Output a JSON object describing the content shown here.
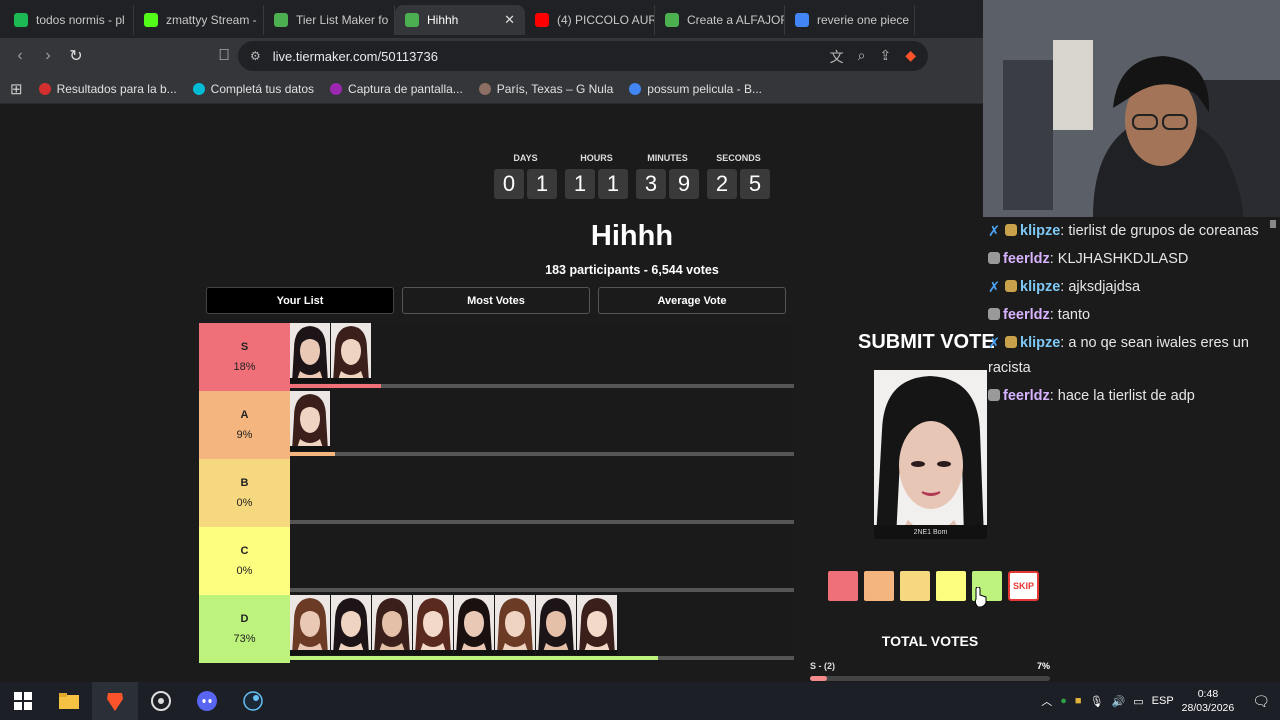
{
  "browser": {
    "tabs": [
      {
        "label": "todos normis - pl",
        "color": "#1db954"
      },
      {
        "label": "zmattyy Stream -",
        "color": "#53fc18"
      },
      {
        "label": "Tier List Maker fo",
        "color": "#4caf50"
      },
      {
        "label": "Hihhh",
        "color": "#4caf50",
        "active": true
      },
      {
        "label": "(4) PICCOLO AUR",
        "color": "#ff0000"
      },
      {
        "label": "Create a ALFAJOR",
        "color": "#4caf50"
      },
      {
        "label": "reverie one piece",
        "color": "#4285f4"
      }
    ],
    "close_glyph": "✕",
    "url": "live.tiermaker.com/50113736",
    "bookmarks": [
      {
        "label": "Resultados para la b...",
        "color": "#d32f2f"
      },
      {
        "label": "Completá tus datos",
        "color": "#00bcd4"
      },
      {
        "label": "Captura de pantalla...",
        "color": "#9c27b0"
      },
      {
        "label": "París, Texas – G Nula",
        "color": "#8d6e63"
      },
      {
        "label": "possum pelicula - B...",
        "color": "#4285f4"
      }
    ]
  },
  "countdown": {
    "units": [
      {
        "label": "DAYS",
        "digits": [
          "0",
          "1"
        ]
      },
      {
        "label": "HOURS",
        "digits": [
          "1",
          "1"
        ]
      },
      {
        "label": "MINUTES",
        "digits": [
          "3",
          "9"
        ]
      },
      {
        "label": "SECONDS",
        "digits": [
          "2",
          "5"
        ]
      }
    ]
  },
  "page": {
    "title": "Hihhh",
    "subtitle": "183 participants - 6,544 votes",
    "view_tabs": [
      "Your List",
      "Most Votes",
      "Average Vote"
    ]
  },
  "tiers": [
    {
      "name": "S",
      "pct": "18%",
      "color": "#f0707a",
      "bar_fill": 0.18,
      "bar_color": "#f0707a",
      "items": 2
    },
    {
      "name": "A",
      "pct": "9%",
      "color": "#f4b57e",
      "bar_fill": 0.09,
      "bar_color": "#f4b57e",
      "items": 1
    },
    {
      "name": "B",
      "pct": "0%",
      "color": "#f6d97f",
      "bar_fill": 0.0,
      "bar_color": "#f6d97f",
      "items": 0
    },
    {
      "name": "C",
      "pct": "0%",
      "color": "#fdfd80",
      "bar_fill": 0.0,
      "bar_color": "#fdfd80",
      "items": 0
    },
    {
      "name": "D",
      "pct": "73%",
      "color": "#bdf37c",
      "bar_fill": 0.73,
      "bar_color": "#bdf37c",
      "items": 8
    }
  ],
  "vote": {
    "heading": "SUBMIT VOTE",
    "caption": "2NE1 Bom",
    "skip_label": "SKIP",
    "total_heading": "TOTAL VOTES",
    "total_row_label": "S - (2)",
    "total_row_pct": "7%",
    "total_fill": 0.07
  },
  "chat": [
    {
      "user": "klipze",
      "text": ": tierlist de grupos de coreanas",
      "user_color": "#7ec8f5",
      "badges": [
        "pin",
        "badge"
      ]
    },
    {
      "user": "feerldz",
      "text": ": KLJHASHKDJLASD",
      "user_color": "#d7b3ff",
      "badges": [
        "badge2"
      ]
    },
    {
      "user": "klipze",
      "text": ": ajksdjajdsa",
      "user_color": "#7ec8f5",
      "badges": [
        "pin",
        "badge"
      ]
    },
    {
      "user": "feerldz",
      "text": ": tanto",
      "user_color": "#d7b3ff",
      "badges": [
        "badge2"
      ]
    },
    {
      "user": "klipze",
      "text": ": a no qe sean iwales eres un racista",
      "user_color": "#7ec8f5",
      "badges": [
        "pin",
        "badge"
      ]
    },
    {
      "user": "feerldz",
      "text": ": hace la tierlist de adp",
      "user_color": "#d7b3ff",
      "badges": [
        "badge2"
      ]
    }
  ],
  "taskbar": {
    "lang": "ESP",
    "time": "0:48",
    "date": "28/03/2026"
  }
}
